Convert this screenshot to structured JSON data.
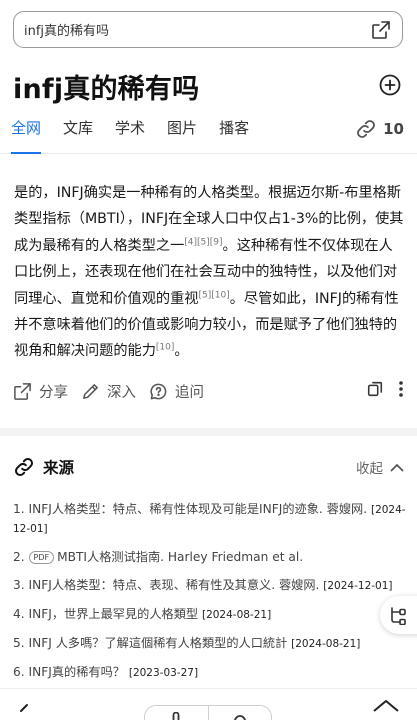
{
  "search": {
    "query": "infj真的稀有吗"
  },
  "header": {
    "title": "infj真的稀有吗"
  },
  "tabs": [
    {
      "label": "全网",
      "active": true
    },
    {
      "label": "文库"
    },
    {
      "label": "学术"
    },
    {
      "label": "图片"
    },
    {
      "label": "播客"
    }
  ],
  "source_count": "10",
  "answer": {
    "part1": "是的，INFJ确实是一种稀有的人格类型。根据迈尔斯-布里格斯类型指标（MBTI），INFJ在全球人口中仅占1-3%的比例，使其成为最稀有的人格类型之一",
    "cite1": "[4][5][9]",
    "part2": "。这种稀有性不仅体现在人口比例上，还表现在他们在社会互动中的独特性，以及他们对同理心、直觉和价值观的重视",
    "cite2": "[5][10]",
    "part3": "。尽管如此，INFJ的稀有性并不意味着他们的价值或影响力较小，而是赋予了他们独特的视角和解决问题的能力",
    "cite3": "[10]",
    "part4": "。"
  },
  "actions": {
    "share": "分享",
    "dive": "深入",
    "follow": "追问"
  },
  "sources": {
    "title": "来源",
    "collapse": "收起",
    "items": [
      {
        "index": "1.",
        "text": "INFJ人格类型：特点、稀有性体现及可能是INFJ的迹象. 蓉嫂网.",
        "date": "[2024-12-01]"
      },
      {
        "index": "2.",
        "badge": "PDF",
        "text": "MBTI人格测试指南. Harley Friedman et al.",
        "date": ""
      },
      {
        "index": "3.",
        "text": "INFJ人格类型：特点、表现、稀有性及其意义. 蓉嫂网.",
        "date": "[2024-12-01]"
      },
      {
        "index": "4.",
        "text": "INFJ，世界上最罕見的人格類型",
        "date": "[2024-08-21]"
      },
      {
        "index": "5.",
        "text": "INFJ 人多嗎？了解這個稀有人格類型的人口統計",
        "date": "[2024-08-21]"
      },
      {
        "index": "6.",
        "text": "INFJ真的稀有吗？",
        "date": "[2023-03-27]"
      }
    ]
  },
  "colors": {
    "accent": "#1a73e8",
    "text": "#1a1a1a",
    "muted": "#555555"
  },
  "icons": {
    "share_out": "external-share-icon",
    "add": "plus-circle-icon",
    "link": "link-icon",
    "copy": "copy-icon",
    "more": "more-vertical-icon",
    "sources": "link-icon",
    "collapse": "chevron-up-icon"
  }
}
